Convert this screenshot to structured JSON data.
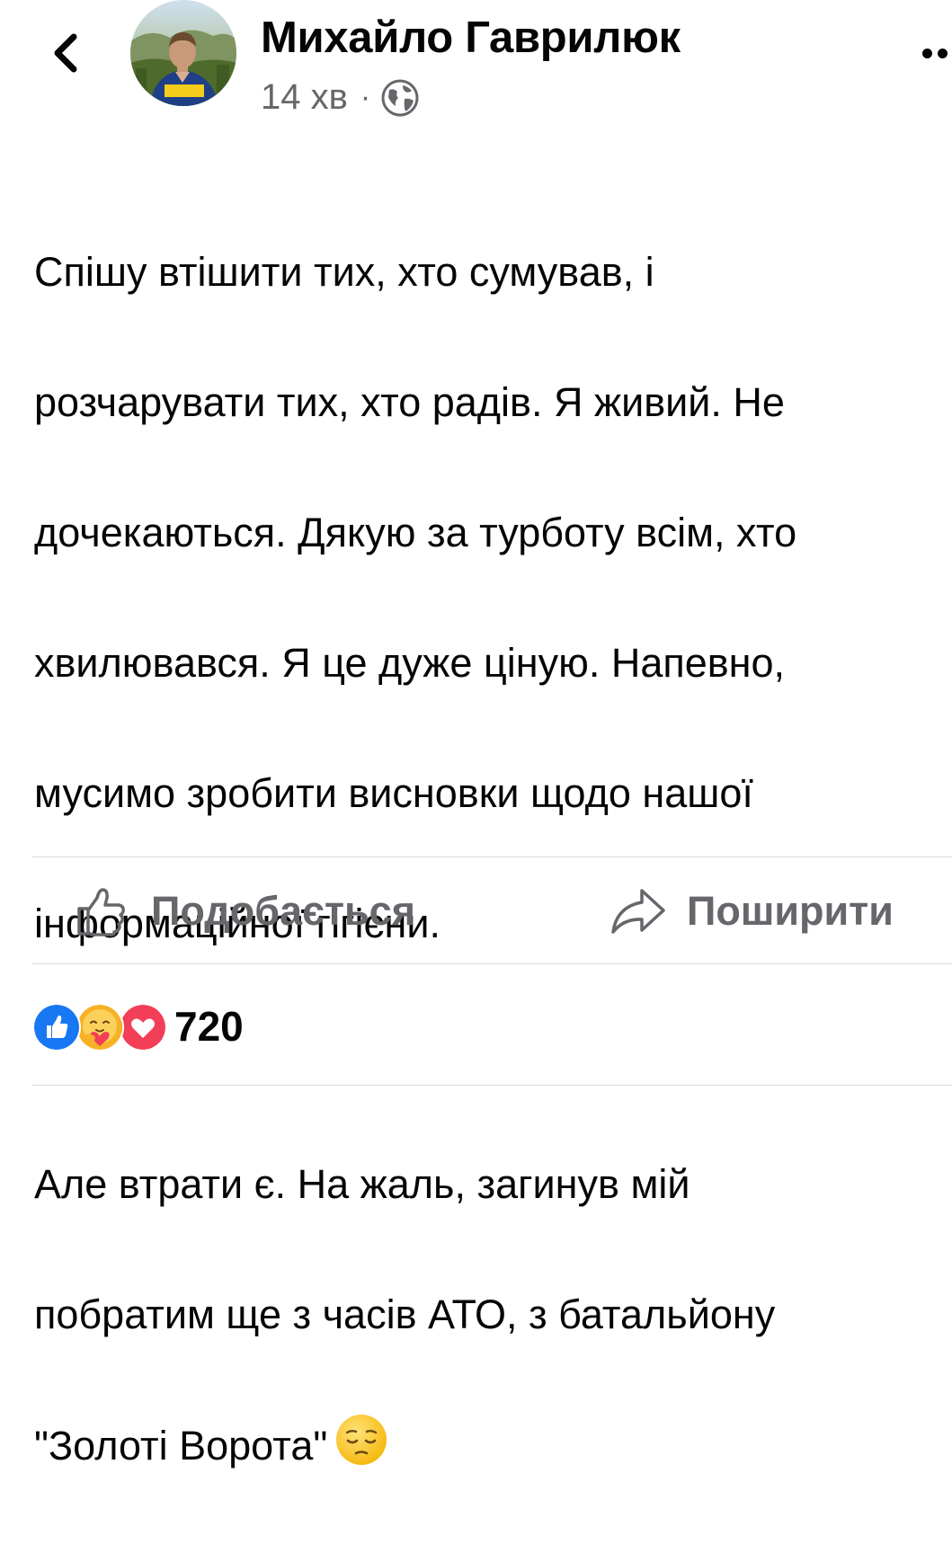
{
  "header": {
    "back_icon": "chevron-left-icon",
    "author_name": "Михайло Гаврилюк",
    "time": "14 хв",
    "separator": "·",
    "privacy_icon": "globe-icon",
    "more_icon": "more-options-icon"
  },
  "post": {
    "lines": [
      "Спішу втішити тих, хто сумував, і",
      "розчарувати тих, хто радів. Я живий. Не",
      "дочекаються. Дякую за турботу всім, хто",
      "хвилювався. Я це дуже ціную. Напевно,",
      "мусимо зробити висновки щодо нашої",
      "інформаційної гігієни.",
      "Але втрати є. На жаль, загинув мій",
      "побратим ще з часів АТО, з батальйону",
      "\"Золоті Ворота\""
    ],
    "emoji_icon": "pensive-face-emoji"
  },
  "actions": {
    "like_label": "Подобається",
    "share_label": "Поширити"
  },
  "reactions": {
    "icons": [
      "like-reaction-icon",
      "care-reaction-icon",
      "love-reaction-icon"
    ],
    "count": "720"
  },
  "colors": {
    "text": "#050505",
    "secondary_text": "#65676b",
    "like_blue": "#1877f2",
    "love_red": "#f33e58",
    "care_yellow": "#f7b125",
    "divider": "#d7d9dc"
  }
}
